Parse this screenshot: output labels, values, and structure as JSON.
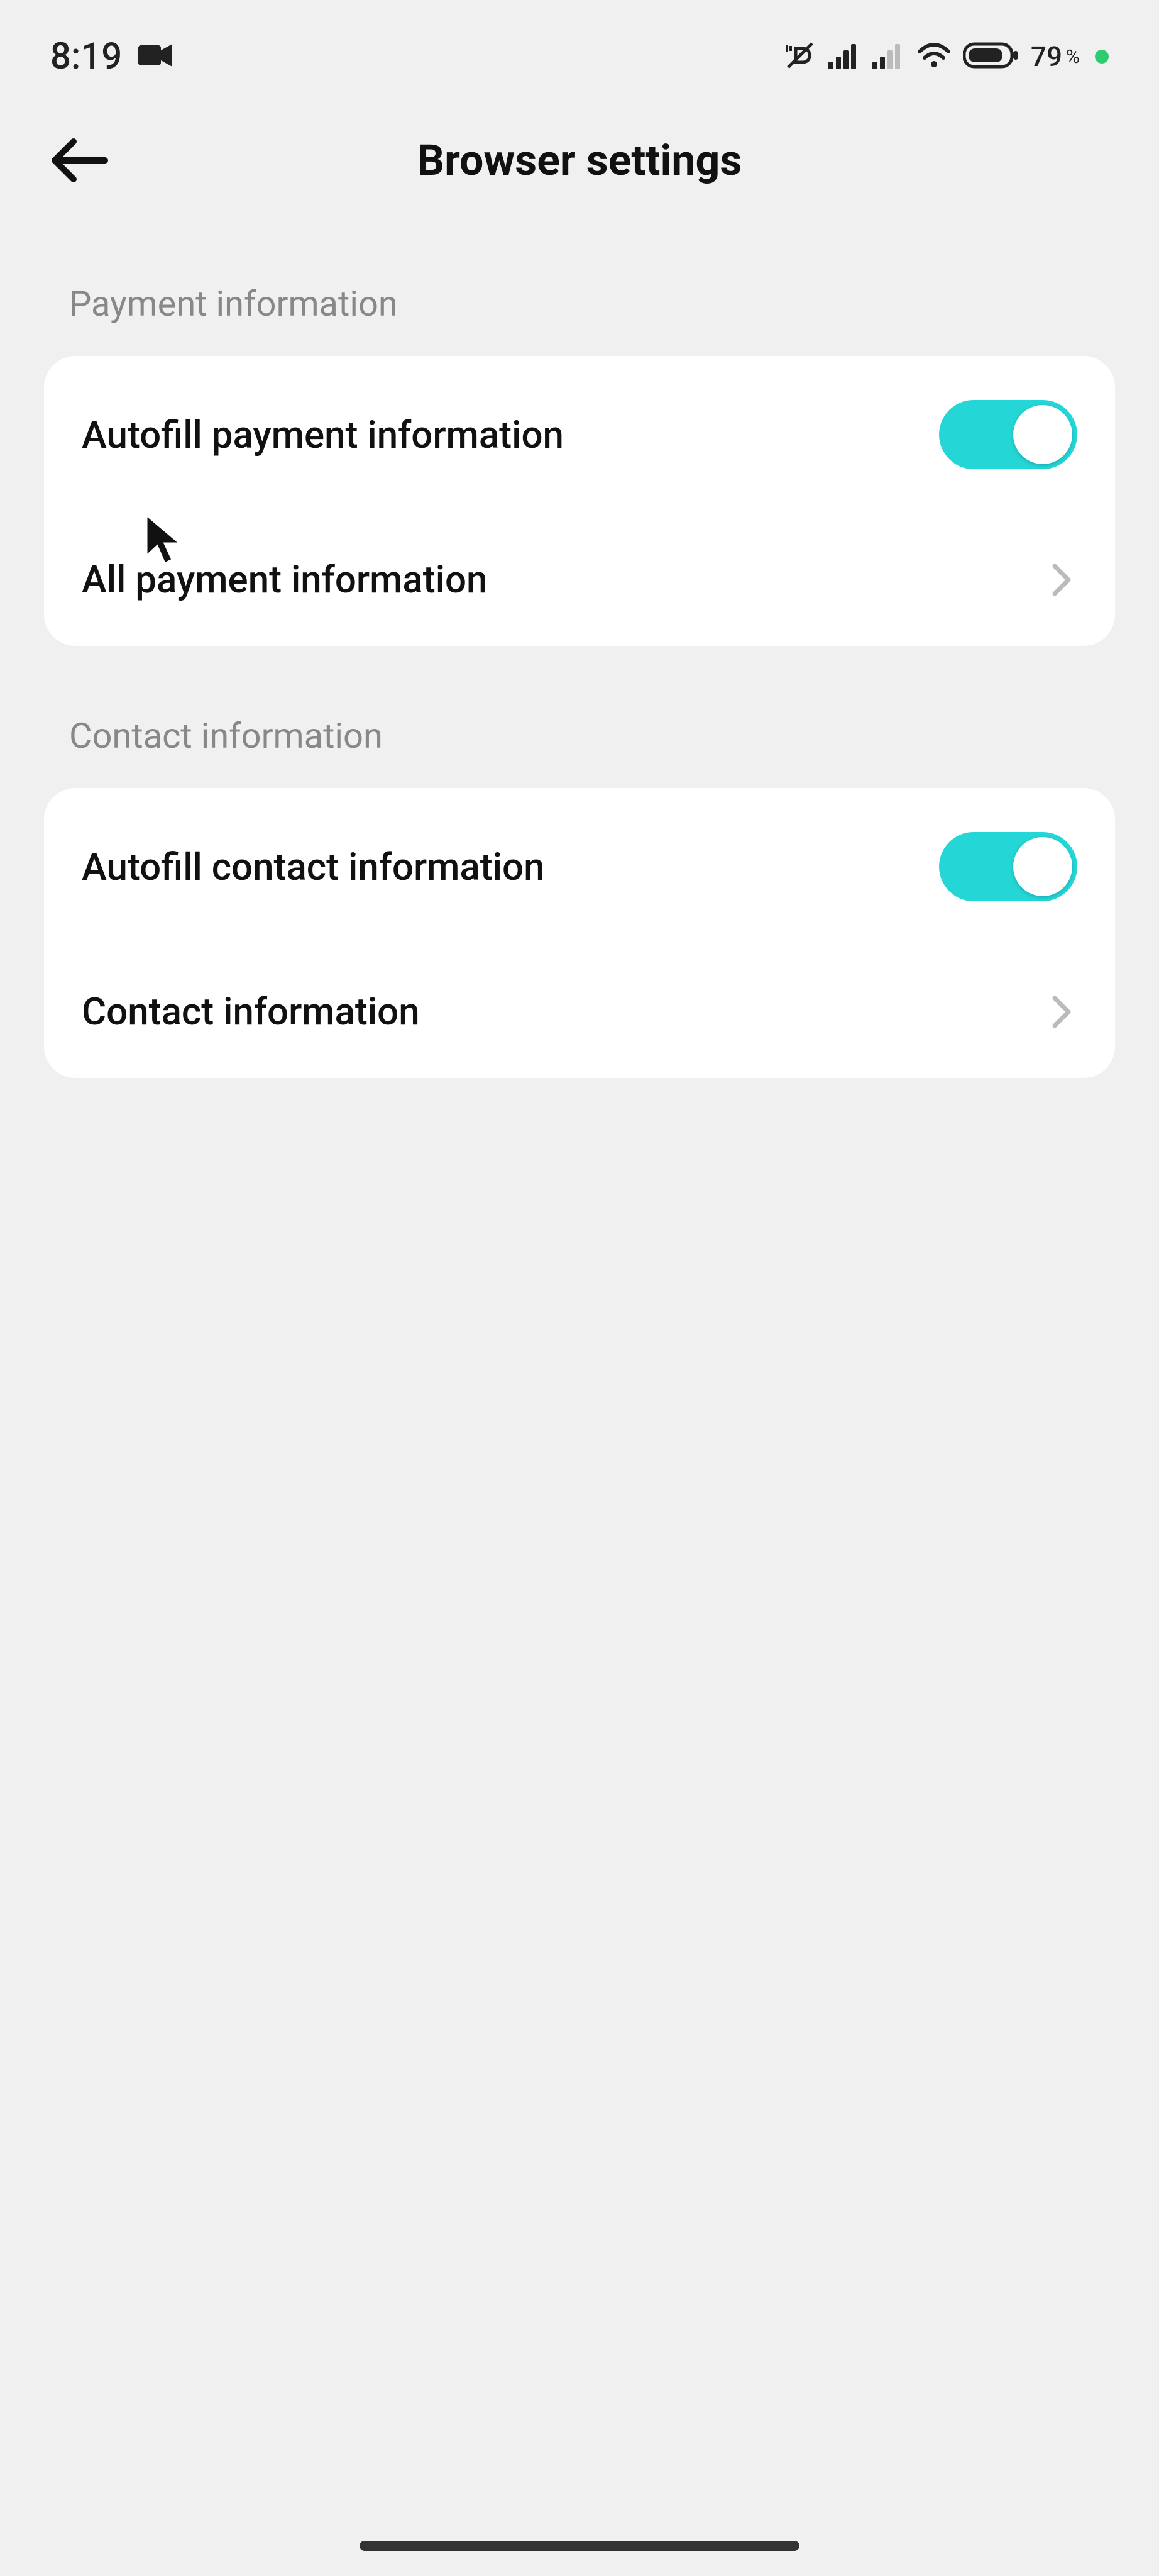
{
  "status": {
    "time": "8:19",
    "battery_pct": "79",
    "battery_pct_suffix": "%"
  },
  "header": {
    "title": "Browser settings"
  },
  "sections": {
    "payment": {
      "header": "Payment information",
      "rows": {
        "autofill": {
          "label": "Autofill payment information",
          "toggle_on": true
        },
        "all": {
          "label": "All payment information"
        }
      }
    },
    "contact": {
      "header": "Contact information",
      "rows": {
        "autofill": {
          "label": "Autofill contact information",
          "toggle_on": true
        },
        "info": {
          "label": "Contact information"
        }
      }
    }
  }
}
